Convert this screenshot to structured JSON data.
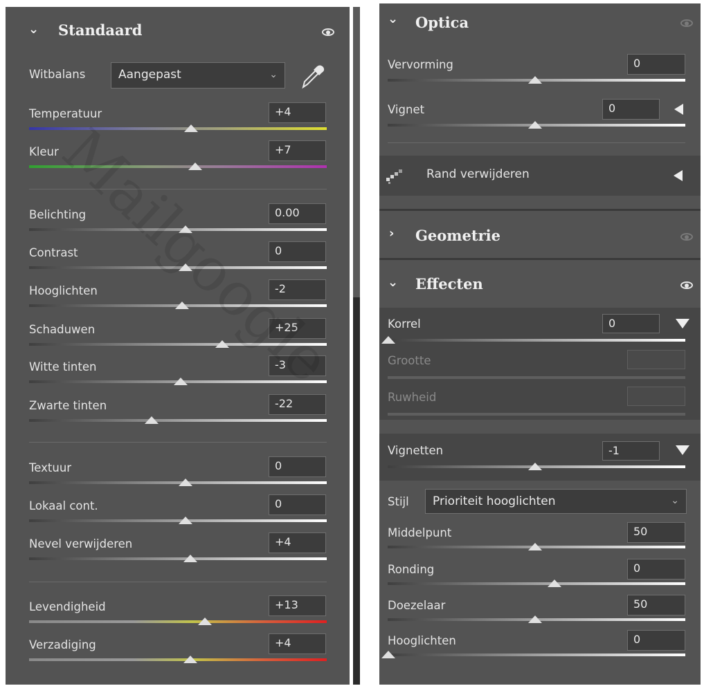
{
  "left": {
    "header": "Standaard",
    "whitebalance": {
      "label": "Witbalans",
      "value": "Aangepast"
    },
    "sliders": [
      {
        "id": "temperatuur",
        "label": "Temperatuur",
        "value": "+4"
      },
      {
        "id": "kleur",
        "label": "Kleur",
        "value": "+7"
      },
      {
        "id": "belichting",
        "label": "Belichting",
        "value": "0.00"
      },
      {
        "id": "contrast",
        "label": "Contrast",
        "value": "0"
      },
      {
        "id": "hooglichten",
        "label": "Hooglichten",
        "value": "-2"
      },
      {
        "id": "schaduwen",
        "label": "Schaduwen",
        "value": "+25"
      },
      {
        "id": "witte-tinten",
        "label": "Witte tinten",
        "value": "-3"
      },
      {
        "id": "zwarte-tinten",
        "label": "Zwarte tinten",
        "value": "-22"
      },
      {
        "id": "textuur",
        "label": "Textuur",
        "value": "0"
      },
      {
        "id": "lokaal-cont",
        "label": "Lokaal cont.",
        "value": "0"
      },
      {
        "id": "nevel-verwijderen",
        "label": "Nevel verwijderen",
        "value": "+4"
      },
      {
        "id": "levendigheid",
        "label": "Levendigheid",
        "value": "+13"
      },
      {
        "id": "verzadiging",
        "label": "Verzadiging",
        "value": "+4"
      }
    ]
  },
  "right": {
    "optica": {
      "header": "Optica",
      "sliders": [
        {
          "id": "vervorming",
          "label": "Vervorming",
          "value": "0"
        },
        {
          "id": "vignet",
          "label": "Vignet",
          "value": "0"
        }
      ],
      "rand_label": "Rand verwijderen"
    },
    "geometrie": {
      "header": "Geometrie"
    },
    "effecten": {
      "header": "Effecten",
      "korrel": {
        "label": "Korrel",
        "value": "0"
      },
      "grootte": {
        "label": "Grootte"
      },
      "ruwheid": {
        "label": "Ruwheid"
      },
      "vignetten": {
        "label": "Vignetten",
        "value": "-1"
      },
      "stijl": {
        "label": "Stijl",
        "value": "Prioriteit hooglichten"
      },
      "sliders": [
        {
          "id": "middelpunt",
          "label": "Middelpunt",
          "value": "50"
        },
        {
          "id": "ronding",
          "label": "Ronding",
          "value": "0"
        },
        {
          "id": "doezelaar",
          "label": "Doezelaar",
          "value": "50"
        },
        {
          "id": "hooglichten-eff",
          "label": "Hooglichten",
          "value": "0"
        }
      ]
    }
  },
  "watermark": "Mailgoogle"
}
